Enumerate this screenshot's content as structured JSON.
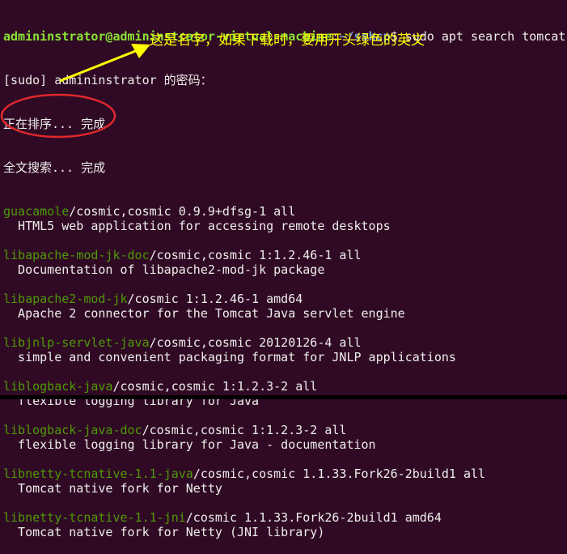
{
  "prompt": {
    "user_host": "admininstrator@admininstrator-virtual-machine",
    "path": "~/sshcp",
    "symbol": "$",
    "command": " sudo apt search tomcat"
  },
  "output": {
    "sudo_prompt": "[sudo] admininstrator 的密码：",
    "sorting": "正在排序... 完成",
    "fulltext": "全文搜索... 完成"
  },
  "packages": [
    {
      "name": "guacamole",
      "info": "/cosmic,cosmic 0.9.9+dfsg-1 all",
      "desc": "  HTML5 web application for accessing remote desktops"
    },
    {
      "name": "libapache-mod-jk-doc",
      "info": "/cosmic,cosmic 1:1.2.46-1 all",
      "desc": "  Documentation of libapache2-mod-jk package"
    },
    {
      "name": "libapache2-mod-jk",
      "info": "/cosmic 1:1.2.46-1 amd64",
      "desc": "  Apache 2 connector for the Tomcat Java servlet engine"
    },
    {
      "name": "libjnlp-servlet-java",
      "info": "/cosmic,cosmic 20120126-4 all",
      "desc": "  simple and convenient packaging format for JNLP applications"
    },
    {
      "name": "liblogback-java",
      "info": "/cosmic,cosmic 1:1.2.3-2 all",
      "desc": "  flexible logging library for Java"
    },
    {
      "name": "liblogback-java-doc",
      "info": "/cosmic,cosmic 1:1.2.3-2 all",
      "desc": "  flexible logging library for Java - documentation"
    },
    {
      "name": "libnetty-tcnative-1.1-java",
      "info": "/cosmic,cosmic 1.1.33.Fork26-2build1 all",
      "desc": "  Tomcat native fork for Netty"
    },
    {
      "name": "libnetty-tcnative-1.1-jni",
      "info": "/cosmic 1.1.33.Fork26-2build1 amd64",
      "desc": "  Tomcat native fork for Netty (JNI library)"
    }
  ],
  "annotation": {
    "text": "这是名字，如果下载时，要用开头绿色的英文",
    "text_color": "#ffff00",
    "arrow_color": "#ffff00",
    "circle_color": "#e0282c"
  },
  "colors": {
    "background": "#300a24",
    "prompt_user": "#8ae234",
    "prompt_path": "#729fcf",
    "package_name": "#4e9a06",
    "text": "#eeeeec"
  }
}
